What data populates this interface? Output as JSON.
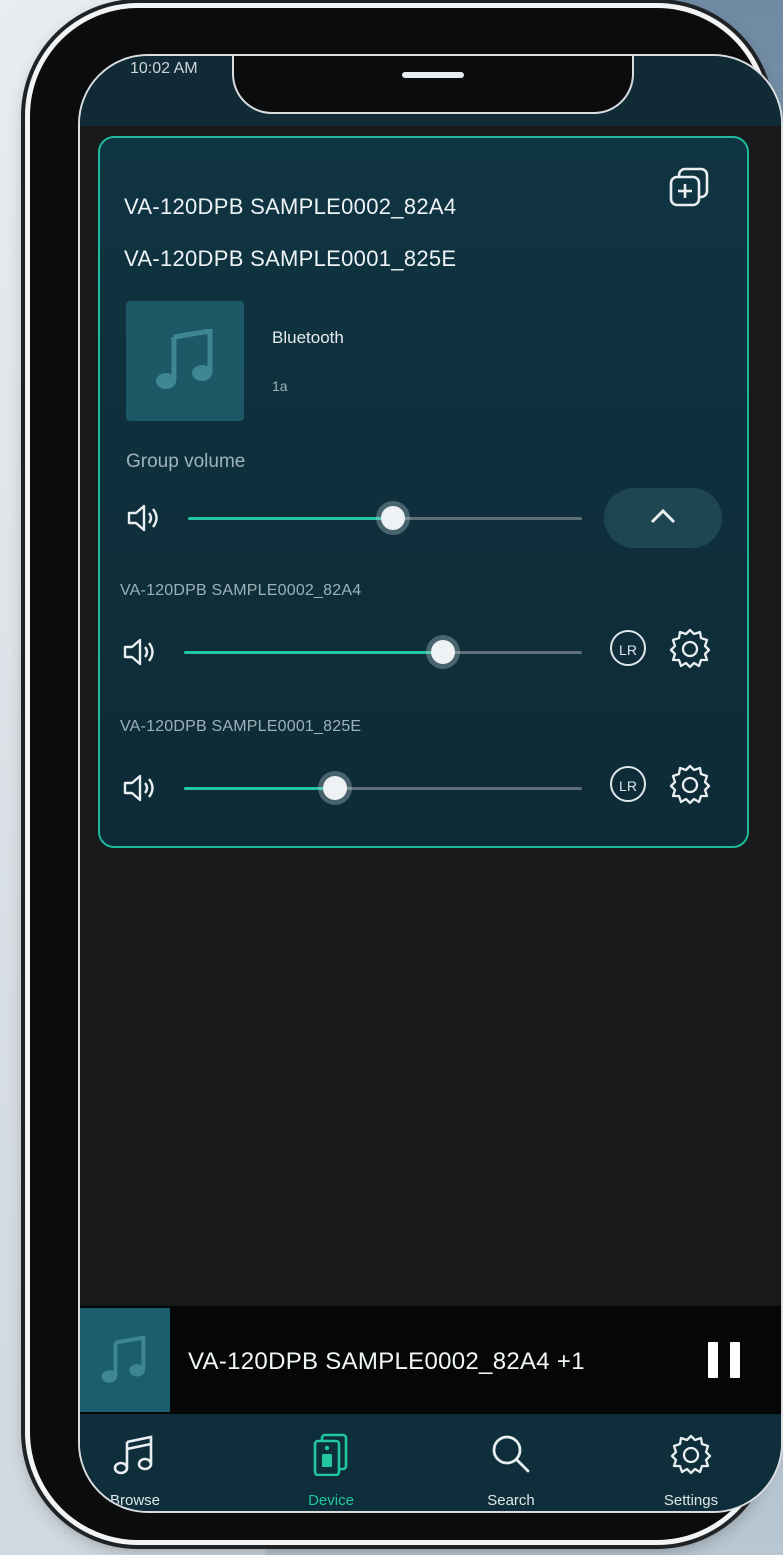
{
  "status_bar": {
    "time": "10:02 AM"
  },
  "group_card": {
    "devices": [
      "VA-120DPB SAMPLE0002_82A4",
      "VA-120DPB SAMPLE0001_825E"
    ],
    "source": {
      "title": "Bluetooth",
      "subtitle": "1a"
    },
    "group_volume_label": "Group volume",
    "group_volume_level": 0.52,
    "speakers": [
      {
        "name": "VA-120DPB SAMPLE0002_82A4",
        "volume": 0.65,
        "lr": "LR"
      },
      {
        "name": "VA-120DPB SAMPLE0001_825E",
        "volume": 0.38,
        "lr": "LR"
      }
    ]
  },
  "now_playing": {
    "title": "VA-120DPB SAMPLE0002_82A4  +1"
  },
  "tabs": [
    {
      "label": "Browse",
      "icon": "music-note-icon"
    },
    {
      "label": "Device",
      "icon": "device-icon"
    },
    {
      "label": "Search",
      "icon": "search-icon"
    },
    {
      "label": "Settings",
      "icon": "gear-icon"
    }
  ],
  "colors": {
    "accent": "#22c79f",
    "card": "#0f3441",
    "tabbar": "#0d2e3a"
  }
}
